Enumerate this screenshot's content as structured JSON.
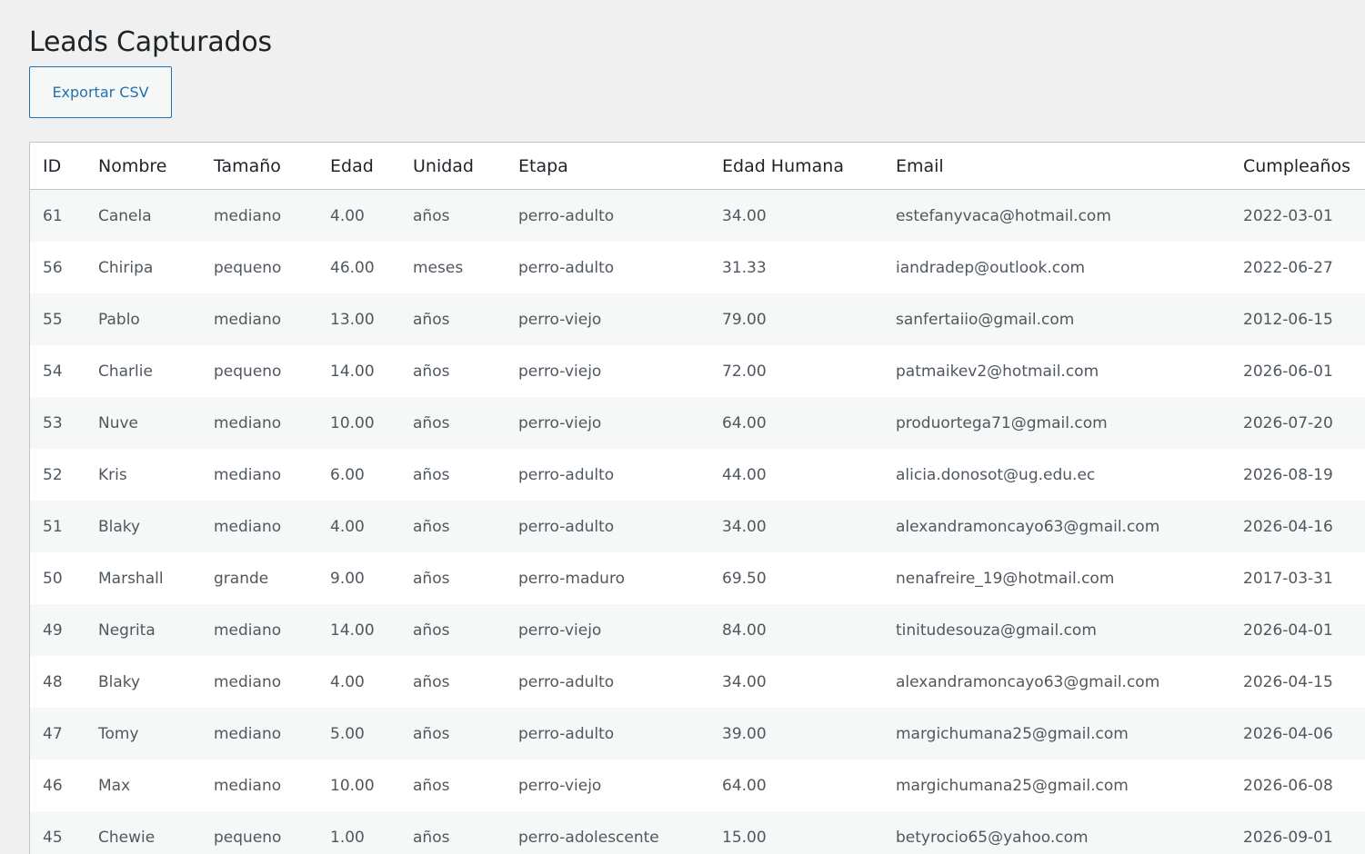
{
  "page": {
    "title": "Leads Capturados",
    "export_label": "Exportar CSV"
  },
  "table": {
    "columns": [
      "ID",
      "Nombre",
      "Tamaño",
      "Edad",
      "Unidad",
      "Etapa",
      "Edad Humana",
      "Email",
      "Cumpleaños"
    ],
    "rows": [
      [
        "61",
        "Canela",
        "mediano",
        "4.00",
        "años",
        "perro-adulto",
        "34.00",
        "estefanyvaca@hotmail.com",
        "2022-03-01"
      ],
      [
        "56",
        "Chiripa",
        "pequeno",
        "46.00",
        "meses",
        "perro-adulto",
        "31.33",
        "iandradep@outlook.com",
        "2022-06-27"
      ],
      [
        "55",
        "Pablo",
        "mediano",
        "13.00",
        "años",
        "perro-viejo",
        "79.00",
        "sanfertaiio@gmail.com",
        "2012-06-15"
      ],
      [
        "54",
        "Charlie",
        "pequeno",
        "14.00",
        "años",
        "perro-viejo",
        "72.00",
        "patmaikev2@hotmail.com",
        "2026-06-01"
      ],
      [
        "53",
        "Nuve",
        "mediano",
        "10.00",
        "años",
        "perro-viejo",
        "64.00",
        "produortega71@gmail.com",
        "2026-07-20"
      ],
      [
        "52",
        "Kris",
        "mediano",
        "6.00",
        "años",
        "perro-adulto",
        "44.00",
        "alicia.donosot@ug.edu.ec",
        "2026-08-19"
      ],
      [
        "51",
        "Blaky",
        "mediano",
        "4.00",
        "años",
        "perro-adulto",
        "34.00",
        "alexandramoncayo63@gmail.com",
        "2026-04-16"
      ],
      [
        "50",
        "Marshall",
        "grande",
        "9.00",
        "años",
        "perro-maduro",
        "69.50",
        "nenafreire_19@hotmail.com",
        "2017-03-31"
      ],
      [
        "49",
        "Negrita",
        "mediano",
        "14.00",
        "años",
        "perro-viejo",
        "84.00",
        "tinitudesouza@gmail.com",
        "2026-04-01"
      ],
      [
        "48",
        "Blaky",
        "mediano",
        "4.00",
        "años",
        "perro-adulto",
        "34.00",
        "alexandramoncayo63@gmail.com",
        "2026-04-15"
      ],
      [
        "47",
        "Tomy",
        "mediano",
        "5.00",
        "años",
        "perro-adulto",
        "39.00",
        "margichumana25@gmail.com",
        "2026-04-06"
      ],
      [
        "46",
        "Max",
        "mediano",
        "10.00",
        "años",
        "perro-viejo",
        "64.00",
        "margichumana25@gmail.com",
        "2026-06-08"
      ],
      [
        "45",
        "Chewie",
        "pequeno",
        "1.00",
        "años",
        "perro-adolescente",
        "15.00",
        "betyrocio65@yahoo.com",
        "2026-09-01"
      ]
    ]
  },
  "colors": {
    "background": "#f0f0f1",
    "accent": "#2271b1",
    "row_stripe": "#f6f7f7",
    "border": "#c3c4c7"
  }
}
